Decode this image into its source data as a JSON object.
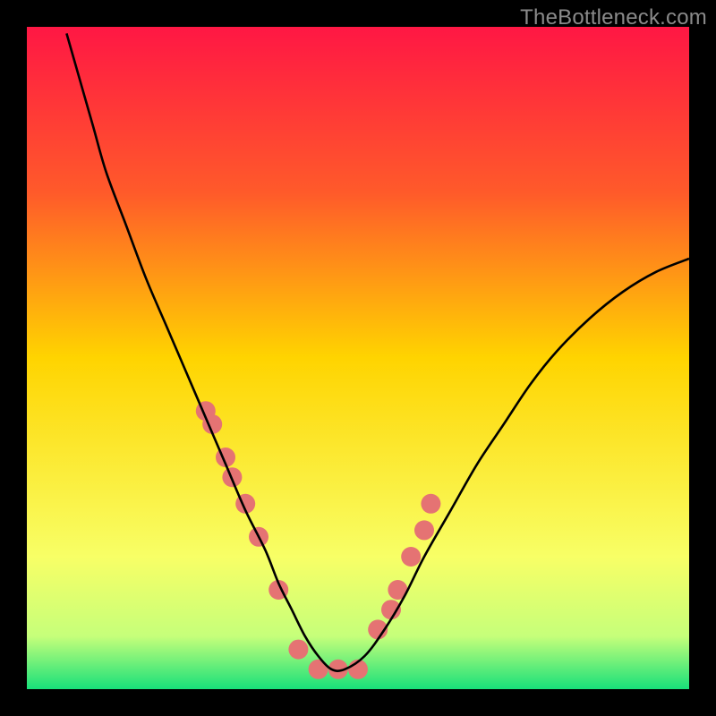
{
  "watermark": "TheBottleneck.com",
  "chart_data": {
    "type": "line",
    "title": "",
    "xlabel": "",
    "ylabel": "",
    "xlim": [
      0,
      100
    ],
    "ylim": [
      0,
      100
    ],
    "grid": false,
    "legend": false,
    "gradient_stops": [
      {
        "offset": 0.0,
        "color": "#ff1744"
      },
      {
        "offset": 0.25,
        "color": "#ff5a2a"
      },
      {
        "offset": 0.5,
        "color": "#ffd400"
      },
      {
        "offset": 0.8,
        "color": "#f8ff66"
      },
      {
        "offset": 0.92,
        "color": "#c6ff7a"
      },
      {
        "offset": 1.0,
        "color": "#18e07a"
      }
    ],
    "series": [
      {
        "name": "bottleneck-curve",
        "color": "#000000",
        "x": [
          6,
          8,
          10,
          12,
          15,
          18,
          21,
          24,
          27,
          30,
          33,
          36,
          38,
          40,
          42,
          44,
          46,
          48,
          51,
          54,
          57,
          60,
          64,
          68,
          72,
          76,
          80,
          85,
          90,
          95,
          100
        ],
        "values": [
          99,
          92,
          85,
          78,
          70,
          62,
          55,
          48,
          41,
          34,
          27,
          21,
          16,
          12,
          8,
          5,
          3,
          3,
          5,
          9,
          14,
          20,
          27,
          34,
          40,
          46,
          51,
          56,
          60,
          63,
          65
        ]
      }
    ],
    "markers": {
      "name": "highlighted-points",
      "color": "#e57373",
      "radius": 11,
      "x": [
        27,
        28,
        30,
        31,
        33,
        35,
        38,
        41,
        44,
        47,
        50,
        53,
        55,
        56,
        58,
        60,
        61
      ],
      "values": [
        42,
        40,
        35,
        32,
        28,
        23,
        15,
        6,
        3,
        3,
        3,
        9,
        12,
        15,
        20,
        24,
        28
      ]
    }
  }
}
